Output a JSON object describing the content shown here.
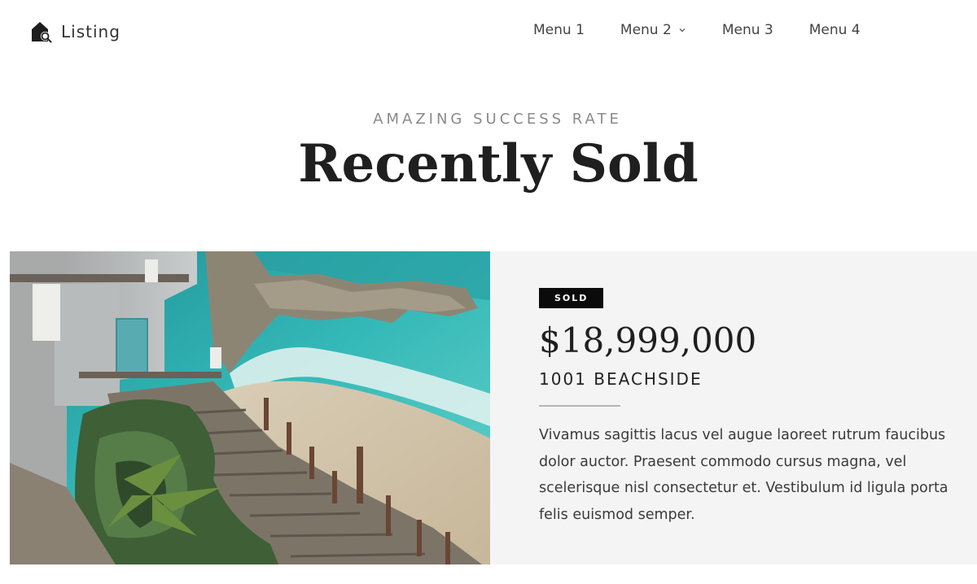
{
  "header": {
    "brand": {
      "icon": "house-search-icon",
      "label": "Listing"
    },
    "nav": [
      {
        "label": "Menu 1"
      },
      {
        "label": "Menu 2",
        "icon": "chevron-down-icon"
      },
      {
        "label": "Menu 3"
      },
      {
        "label": "Menu 4"
      }
    ]
  },
  "section": {
    "eyebrow": "AMAZING SUCCESS RATE",
    "title": "Recently Sold"
  },
  "listing": {
    "badge": "SOLD",
    "price": "$18,999,000",
    "address": "1001 BEACHSIDE",
    "description": "Vivamus sagittis lacus vel augue laoreet rutrum faucibus dolor auctor. Praesent commodo cursus magna, vel scelerisque nisl consectetur et. Vestibulum id ligula porta felis euismod semper.",
    "photo": "beach-house-photo"
  },
  "colors": {
    "card_bg": "#f4f4f4",
    "badge_bg": "#0b0b0b",
    "text": "#222222",
    "muted": "#8a8a8a"
  }
}
